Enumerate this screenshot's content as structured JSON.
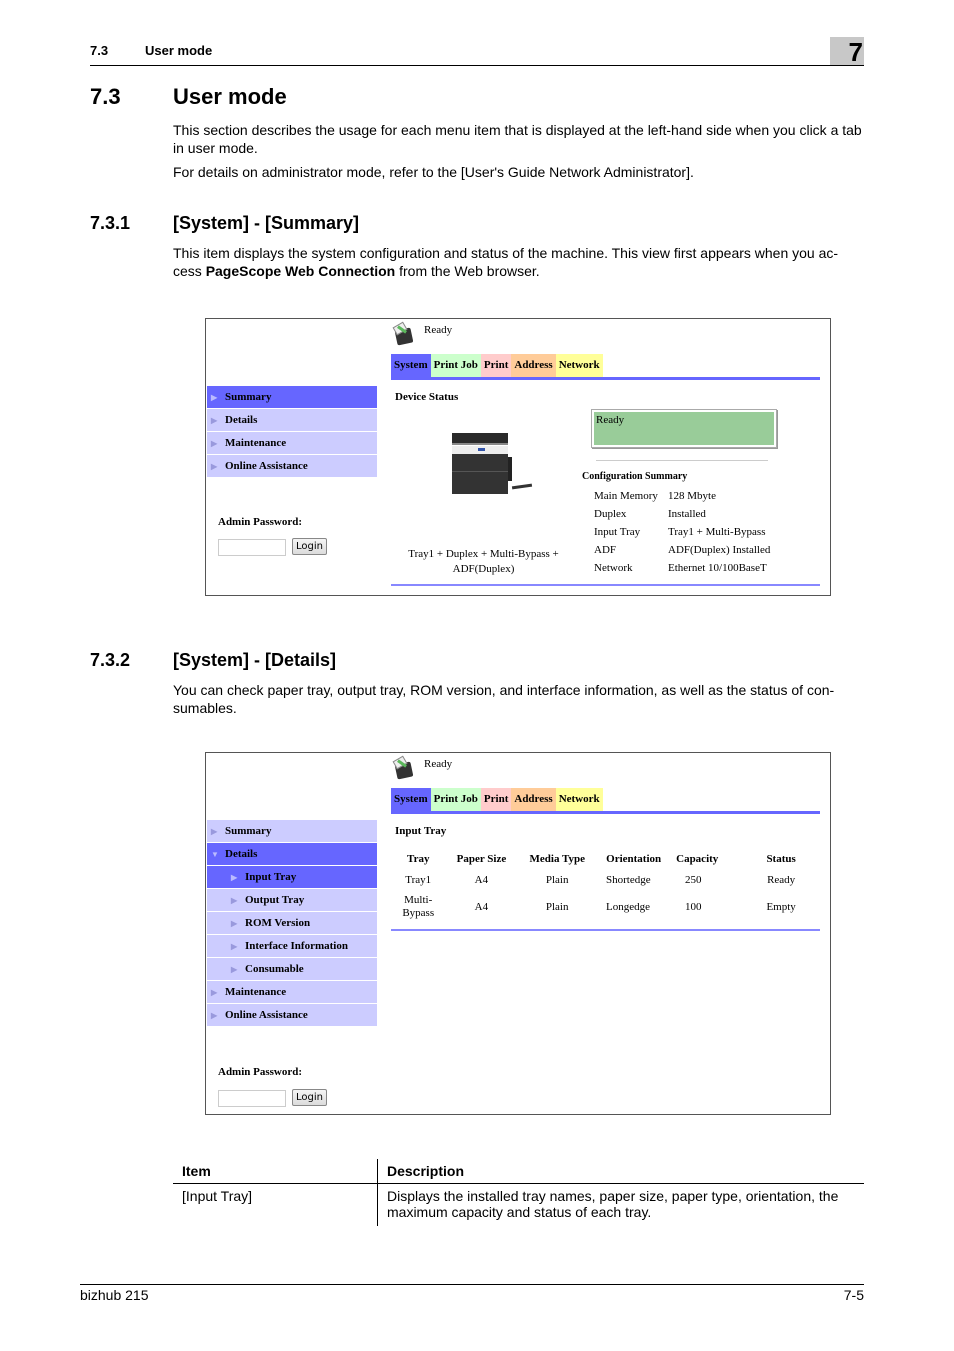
{
  "header": {
    "section_num": "7.3",
    "section_title": "User mode",
    "chapter": "7"
  },
  "section": {
    "num": "7.3",
    "title": "User mode",
    "para1": "This section describes the usage for each menu item that is displayed at the left-hand side when you click a tab in user mode.",
    "para2": "For details on administrator mode, refer to the [User's Guide Network Administrator]."
  },
  "sub1": {
    "num": "7.3.1",
    "title": "[System] - [Summary]",
    "para_prefix": "This item displays the system configuration and status of the machine. This view first appears when you ac-cess ",
    "para_bold": "PageScope Web Connection",
    "para_suffix": " from the Web browser."
  },
  "shot1": {
    "status": "Ready",
    "tabs": [
      "System",
      "Print Job",
      "Print",
      "Address",
      "Network"
    ],
    "menu": [
      "Summary",
      "Details",
      "Maintenance",
      "Online Assistance"
    ],
    "admin_label": "Admin Password:",
    "login": "Login",
    "device_status_title": "Device Status",
    "device_caption_line1": "Tray1 + Duplex + Multi-Bypass +",
    "device_caption_line2": "ADF(Duplex)",
    "ready_box": "Ready",
    "config_title": "Configuration Summary",
    "config": [
      {
        "key": "Main Memory",
        "value": "128 Mbyte"
      },
      {
        "key": "Duplex",
        "value": "Installed"
      },
      {
        "key": "Input Tray",
        "value": "Tray1 + Multi-Bypass"
      },
      {
        "key": "ADF",
        "value": "ADF(Duplex) Installed"
      },
      {
        "key": "Network",
        "value": "Ethernet 10/100BaseT"
      }
    ]
  },
  "sub2": {
    "num": "7.3.2",
    "title": "[System] - [Details]",
    "para": "You can check paper tray, output tray, ROM version, and interface information, as well as the status of con-sumables."
  },
  "shot2": {
    "status": "Ready",
    "tabs": [
      "System",
      "Print Job",
      "Print",
      "Address",
      "Network"
    ],
    "menu": [
      "Summary",
      "Details",
      "Input Tray",
      "Output Tray",
      "ROM Version",
      "Interface Information",
      "Consumable",
      "Maintenance",
      "Online Assistance"
    ],
    "admin_label": "Admin Password:",
    "login": "Login",
    "input_tray_title": "Input Tray",
    "columns": [
      "Tray",
      "Paper Size",
      "Media Type",
      "Orientation",
      "Capacity",
      "Status"
    ],
    "rows": [
      [
        "Tray1",
        "A4",
        "Plain",
        "Shortedge",
        "250",
        "Ready"
      ],
      [
        "Multi-Bypass",
        "A4",
        "Plain",
        "Longedge",
        "100",
        "Empty"
      ]
    ],
    "row2_tray_line1": "Multi-",
    "row2_tray_line2": "Bypass"
  },
  "desc_table": {
    "headers": [
      "Item",
      "Description"
    ],
    "rows": [
      [
        "[Input Tray]",
        "Displays the installed tray names, paper size, paper type, orientation, the maximum capacity and status of each tray."
      ]
    ]
  },
  "footer": {
    "product": "bizhub 215",
    "page": "7-5"
  }
}
